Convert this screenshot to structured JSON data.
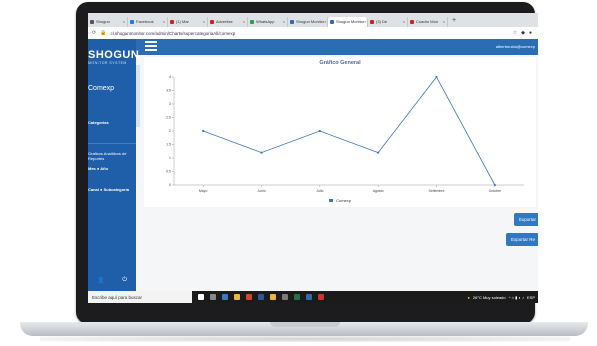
{
  "browser": {
    "tabs": [
      {
        "label": "Shogun",
        "color": "#555555"
      },
      {
        "label": "Facebook",
        "color": "#1877f2"
      },
      {
        "label": "(1) Mar",
        "color": "#cc2222"
      },
      {
        "label": "Advertise",
        "color": "#cc2222"
      },
      {
        "label": "WhatsApp",
        "color": "#25a244"
      },
      {
        "label": "Shogun Monitor",
        "color": "#2b6db5"
      },
      {
        "label": "Shogun Monitor",
        "color": "#2b6db5",
        "active": true
      },
      {
        "label": "(3) De",
        "color": "#cc2222"
      },
      {
        "label": "Cuadro Mon",
        "color": "#cc2222"
      }
    ],
    "new_tab": "+",
    "url": "cl.shogunmonitor.com/admin/Charts/supercategoriaAll/comexp"
  },
  "app": {
    "brand": "SHOGUN",
    "brand_sub": "MONITOR SYSTEM",
    "company": "Comexp",
    "user": "albertorubio@comexp",
    "sidebar": {
      "categories": "Categorias",
      "section_title_1": "Graficos Analiticos de",
      "section_title_2": "Reportes",
      "view_mes": "Mes",
      "view_ano": "Año",
      "view_canal": "Canal",
      "view_sub": "Subcategoria",
      "user_icon": "user-icon",
      "power_icon": "power-icon"
    }
  },
  "chart_data": {
    "type": "line",
    "title": "Gráfico General",
    "categories": [
      "Mayo",
      "Junio",
      "Julio",
      "Agosto",
      "Setiembre",
      "Octubre"
    ],
    "series": [
      {
        "name": "Comexp",
        "values": [
          2,
          1.2,
          2,
          1.2,
          4,
          0
        ]
      }
    ],
    "yticks": [
      "0",
      "0.5",
      "1",
      "1.5",
      "2",
      "2.5",
      "3",
      "3.5",
      "4"
    ],
    "ylim": [
      0,
      4
    ],
    "legend": "bottom-center",
    "color": "#3a77c4"
  },
  "buttons": {
    "export_1": "Exportar",
    "export_2": "Exportar Re"
  },
  "taskbar": {
    "search": "Escribe aquí para buscar",
    "weather": "26°C  Muy soleado",
    "lang": "ESP"
  }
}
